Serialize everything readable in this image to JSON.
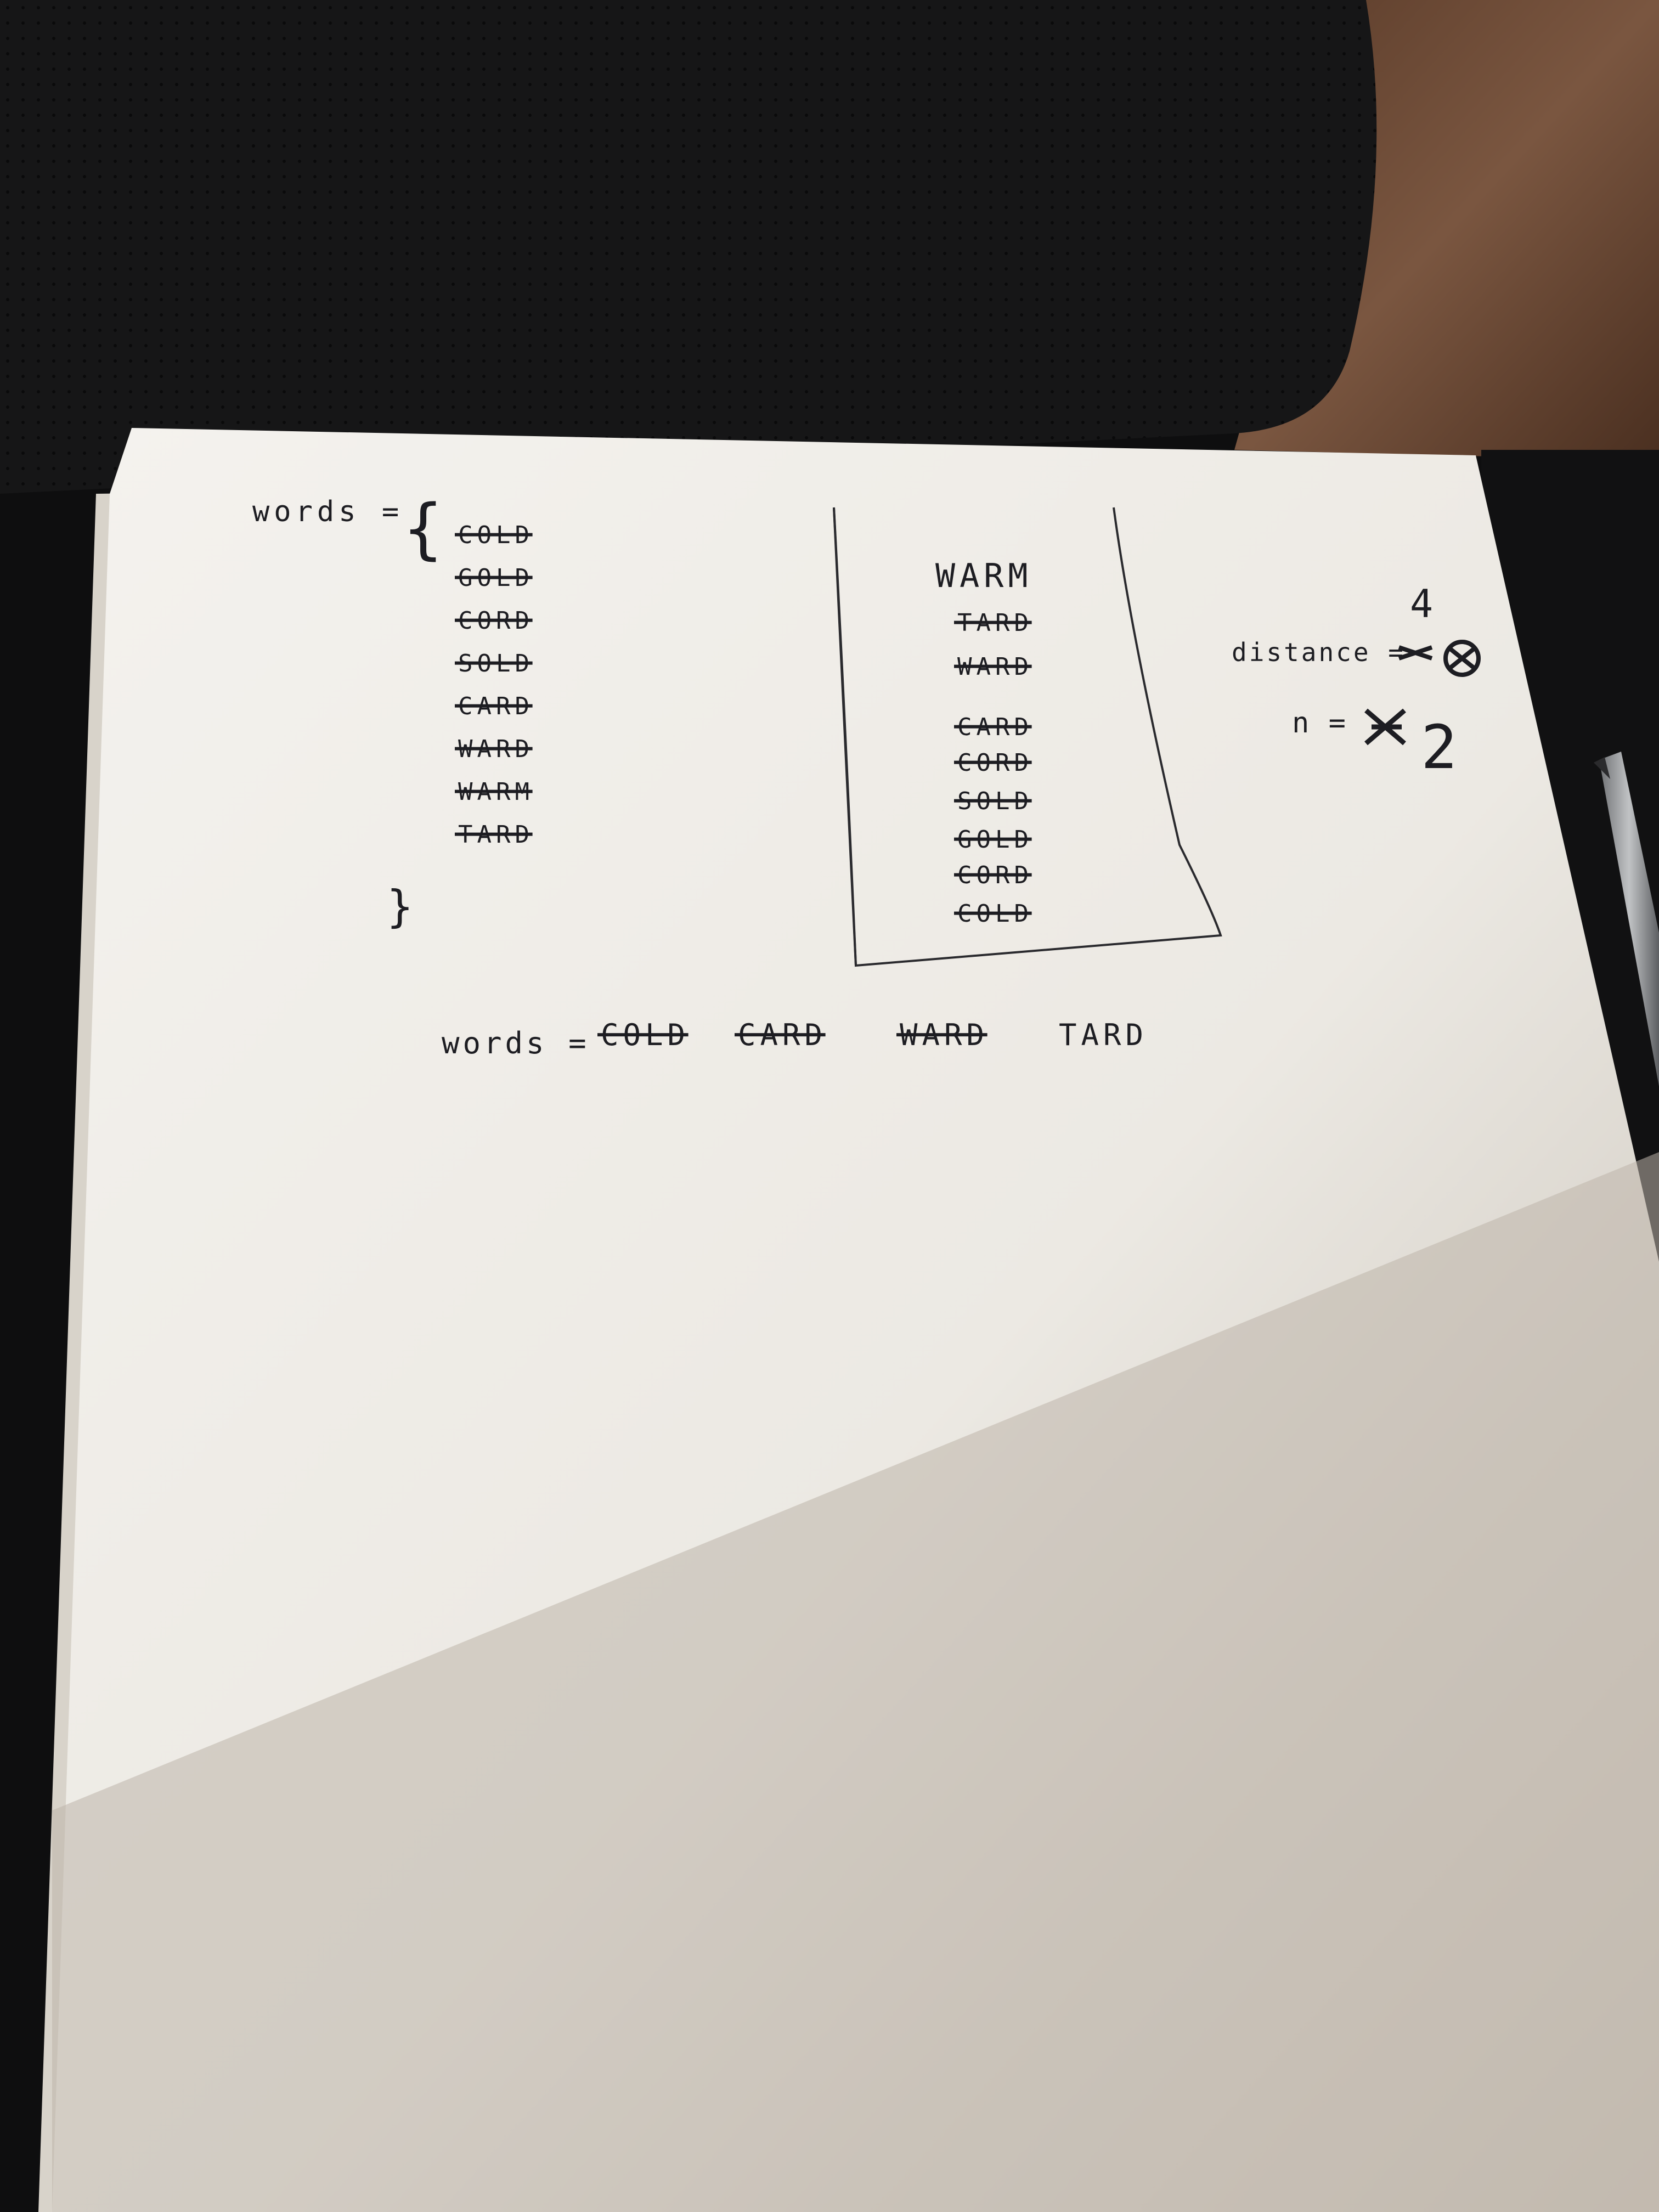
{
  "left_list": {
    "label": "words =",
    "open_brace": "{",
    "close_brace": "}",
    "items": [
      "COLD",
      "GOLD",
      "CORD",
      "SOLD",
      "CARD",
      "WARD",
      "WARM",
      "TARD"
    ]
  },
  "middle_column": {
    "title": "WARM",
    "items": [
      "TARD",
      "WARD",
      "CARD",
      "CORD",
      "SOLD",
      "GOLD",
      "CORD",
      "COLD"
    ]
  },
  "variables": {
    "distance_label": "distance =",
    "distance_value": "4",
    "n_label": "n =",
    "n_value": "2"
  },
  "bottom_line": {
    "label": "words =",
    "items": [
      {
        "text": "COLD",
        "struck": true
      },
      {
        "text": "CARD",
        "struck": true
      },
      {
        "text": "WARD",
        "struck": true
      },
      {
        "text": "TARD",
        "struck": false
      }
    ]
  },
  "colors": {
    "paper": "#efece6",
    "ink": "#1d1d22",
    "leather": "#141415",
    "wood": "#6b4a35",
    "desk": "#0e0e0f",
    "pen": "#a7a9ac"
  }
}
